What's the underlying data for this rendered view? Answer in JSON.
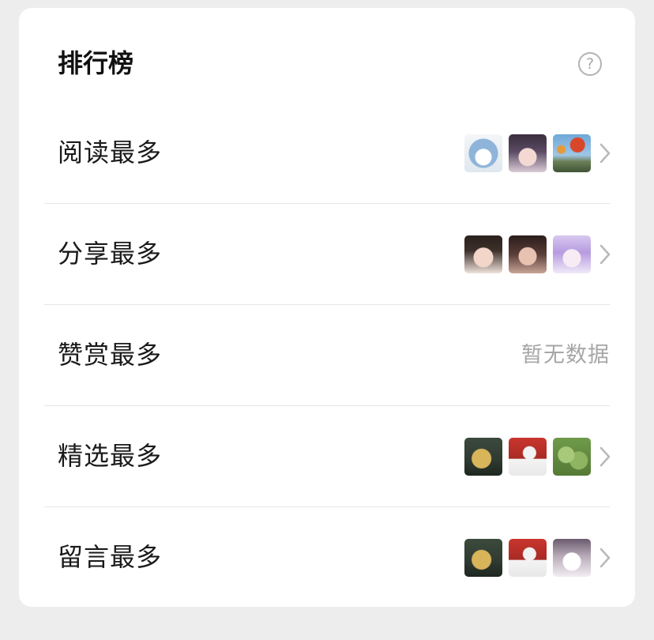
{
  "header": {
    "title": "排行榜",
    "help_icon": "?"
  },
  "rows": [
    {
      "label": "阅读最多",
      "avatars": [
        "crown-emblem-avatar",
        "anime-girl-dark-avatar",
        "hot-air-balloon-avatar"
      ],
      "has_chevron": true
    },
    {
      "label": "分享最多",
      "avatars": [
        "girl-photo-avatar",
        "girl-photo-avatar",
        "anime-girl-purple-avatar"
      ],
      "has_chevron": true
    },
    {
      "label": "赞赏最多",
      "empty_text": "暂无数据",
      "has_chevron": false
    },
    {
      "label": "精选最多",
      "avatars": [
        "golden-figure-avatar",
        "red-poster-avatar",
        "succulent-plant-avatar"
      ],
      "has_chevron": true
    },
    {
      "label": "留言最多",
      "avatars": [
        "golden-figure-avatar",
        "red-poster-avatar",
        "anime-sketch-avatar"
      ],
      "has_chevron": true
    }
  ],
  "colors": {
    "background": "#ededed",
    "card": "#ffffff",
    "title": "#111111",
    "label": "#1a1a1a",
    "muted": "#a6a6a6",
    "divider": "#e6e6e6"
  }
}
